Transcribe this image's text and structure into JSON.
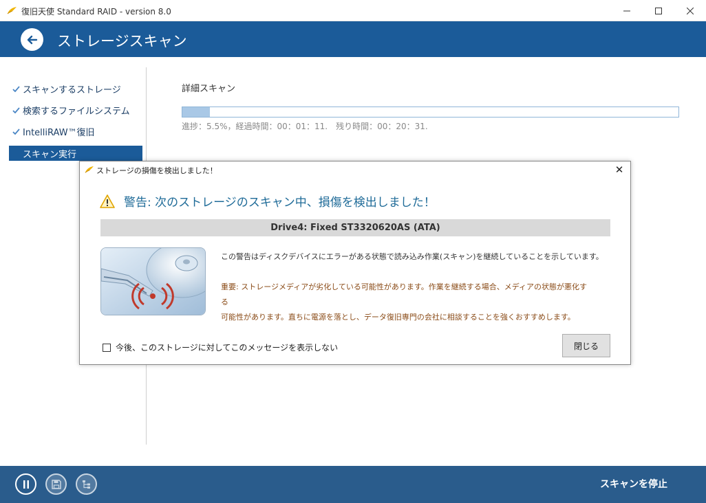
{
  "window": {
    "title": "復旧天使 Standard RAID - version 8.0",
    "minimize": "—",
    "maximize": "☐",
    "close": "✕"
  },
  "header": {
    "title": "ストレージスキャン"
  },
  "sidebar": {
    "steps": [
      {
        "label": "スキャンするストレージ",
        "state": "done"
      },
      {
        "label": "検索するファイルシステム",
        "state": "done"
      },
      {
        "label": "IntelliRAW™復旧",
        "state": "done"
      },
      {
        "label": "スキャン実行",
        "state": "active"
      }
    ]
  },
  "scan": {
    "label": "詳細スキャン",
    "progress_percent": 5.5,
    "progress_text": "進捗：5.5%，経過時間：00：01：11.　残り時間：00：20：31."
  },
  "dialog": {
    "title": "ストレージの損傷を検出しました！",
    "close_glyph": "✕",
    "heading": "警告: 次のストレージのスキャン中、損傷を検出しました！",
    "drive": "Drive4: Fixed ST3320620AS (ATA)",
    "message": "この警告はディスクデバイスにエラーがある状態で読み込み作業(スキャン)を継続していることを示しています。",
    "warning_line1": "重要: ストレージメディアが劣化している可能性があります。作業を継続する場合、メディアの状態が悪化する",
    "warning_line2": "可能性があります。直ちに電源を落とし、データ復旧専門の会社に相談することを強くおすすめします。",
    "dont_show_label": "今後、このストレージに対してこのメッセージを表示しない",
    "dont_show_checked": false,
    "close_label": "閉じる"
  },
  "bottombar": {
    "buttons": [
      {
        "icon": "pause-icon"
      },
      {
        "icon": "save-icon"
      },
      {
        "icon": "tree-icon"
      }
    ],
    "stop_label": "スキャンを停止"
  },
  "colors": {
    "accent": "#1b5b99",
    "bottom_bar": "#2a5c8c",
    "warning_text": "#8a4b17",
    "heading_text": "#1f6b98"
  }
}
